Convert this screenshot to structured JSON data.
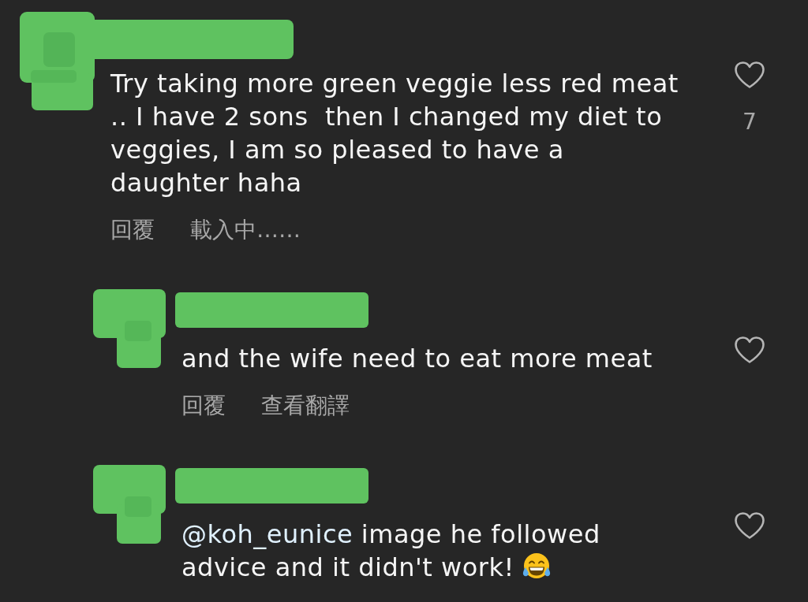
{
  "comments": [
    {
      "text": "Try taking more green veggie less red meat .. I have 2 sons  then I changed my diet to veggies, I am so pleased to have a daughter haha",
      "liked": false,
      "likes": "7",
      "emoji": false,
      "actions": [
        "回覆",
        "載入中……"
      ],
      "replies": [
        {
          "text": "and the wife need to eat more meat",
          "liked": false,
          "emoji": false,
          "actions": [
            "回覆",
            "查看翻譯"
          ]
        },
        {
          "mention": "@koh_eunice",
          "text": "image he followed advice and it didn't work!",
          "liked": false,
          "emoji": true
        }
      ]
    }
  ]
}
